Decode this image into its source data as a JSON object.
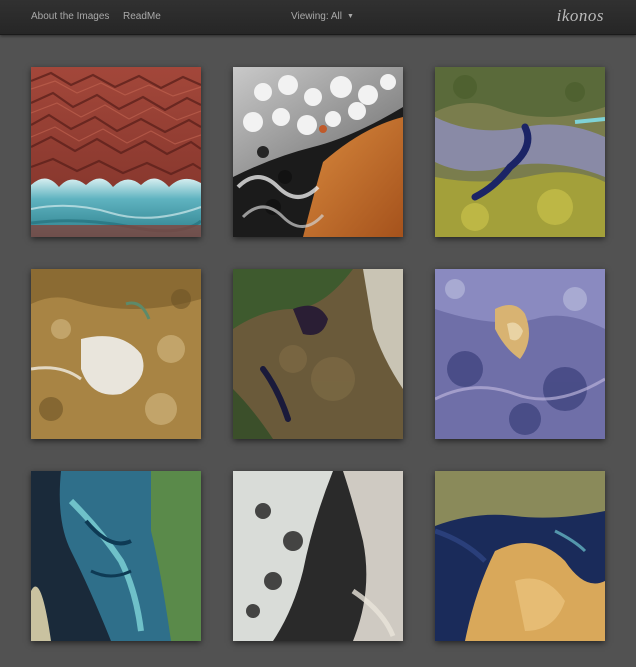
{
  "nav": {
    "about_label": "About the Images",
    "readme_label": "ReadMe",
    "viewing_label": "Viewing: All",
    "brand": "ikonos"
  },
  "gallery": {
    "tiles": [
      {
        "subject": "red-dunes-coast"
      },
      {
        "subject": "clouds-over-desert"
      },
      {
        "subject": "green-mottled-terrain"
      },
      {
        "subject": "salt-flat-desert"
      },
      {
        "subject": "lake-savanna"
      },
      {
        "subject": "purple-mountains"
      },
      {
        "subject": "river-delta"
      },
      {
        "subject": "ice-floes"
      },
      {
        "subject": "peninsula-gulf"
      }
    ]
  },
  "colors": {
    "background": "#525252",
    "topbar": "#2b2b2b",
    "nav_text": "#a9a9a9"
  }
}
